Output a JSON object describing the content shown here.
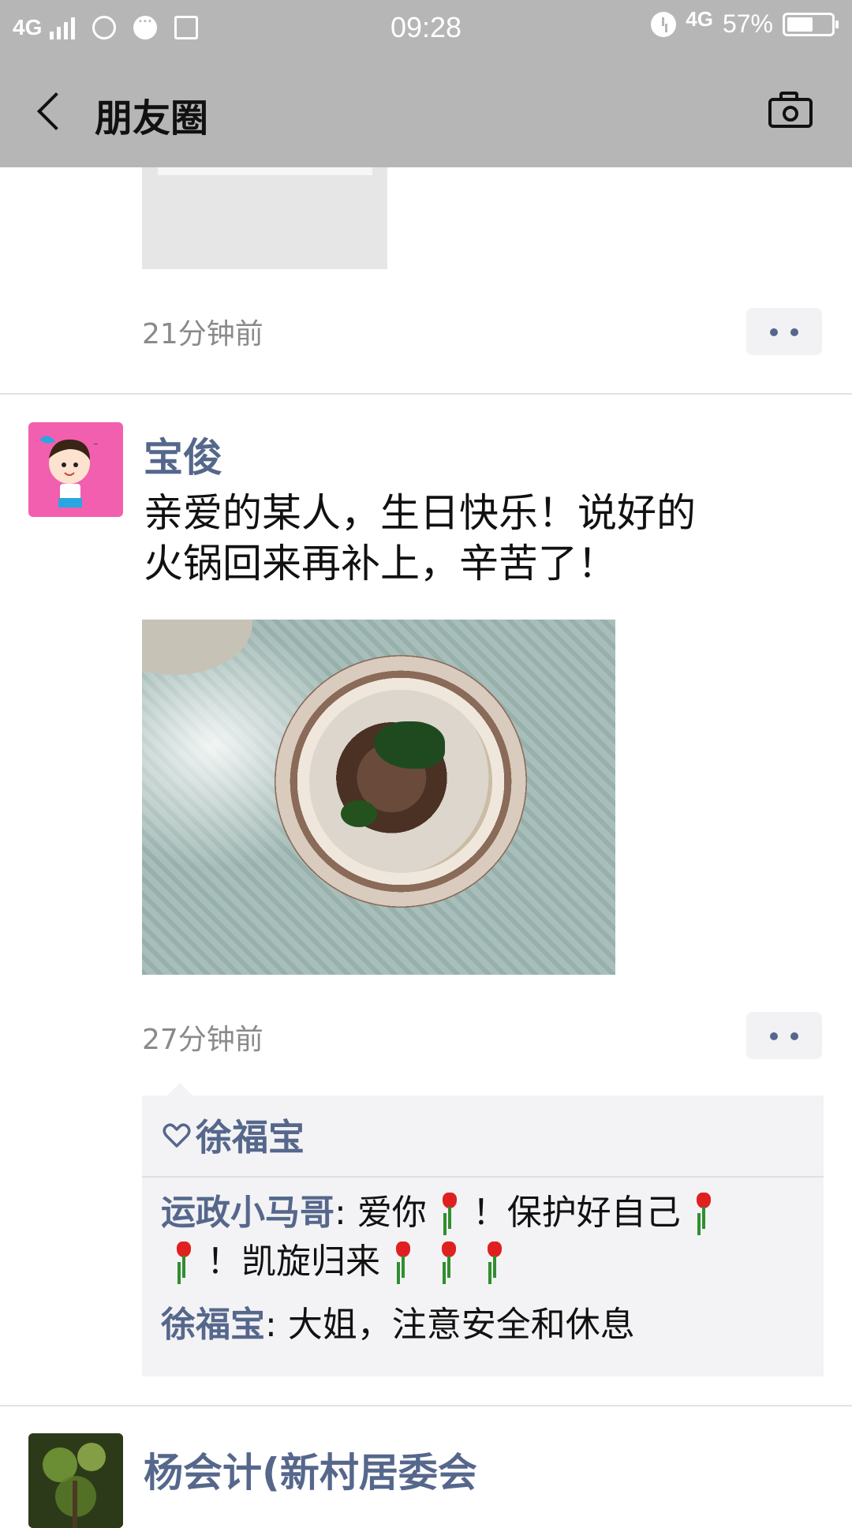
{
  "status_bar": {
    "network": "4G",
    "time": "09:28",
    "network_right": "4G",
    "battery": "57%"
  },
  "title_bar": {
    "title": "朋友圈"
  },
  "previous_post": {
    "timestamp": "21分钟前"
  },
  "post": {
    "author": "宝俊",
    "text_line1": "亲爱的某人，生日快乐！说好的",
    "text_line2": "火锅回来再补上，辛苦了！",
    "timestamp": "27分钟前",
    "likes": [
      "徐福宝"
    ],
    "comments": [
      {
        "user": "运政小马哥",
        "sep": ": ",
        "text_a": "爱你",
        "text_b": "！保护好自己",
        "text_c": "！凯旋归来"
      },
      {
        "user": "徐福宝",
        "sep": ": ",
        "text": "大姐，注意安全和休息"
      }
    ]
  },
  "next_post": {
    "author": "杨会计(新村居委会"
  },
  "colors": {
    "bar_bg": "#b6b6b6",
    "link_blue": "#56678c",
    "comment_bg": "#f3f3f5"
  }
}
